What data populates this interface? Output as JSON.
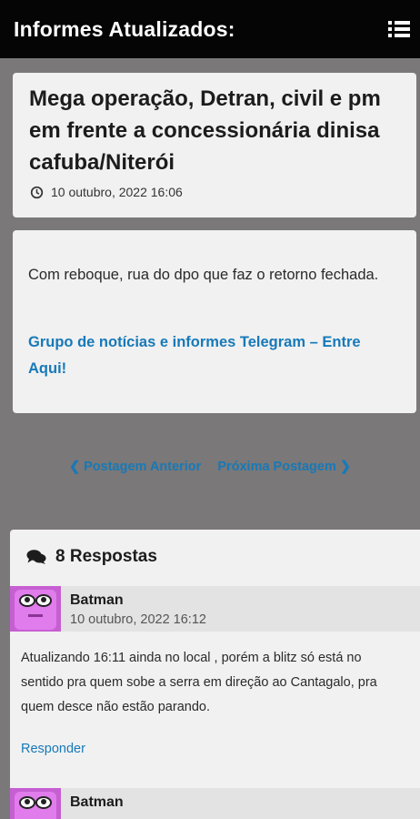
{
  "header": {
    "title": "Informes Atualizados:",
    "menu_icon": "menu-list-icon"
  },
  "post": {
    "title": "Mega operação, Detran, civil e pm em frente a concessionária dinisa cafuba/Niterói",
    "date": "10 outubro, 2022 16:06",
    "body": "Com reboque, rua do dpo que faz o retorno fechada.",
    "link": "Grupo de notícias e informes Telegram – Entre Aqui!"
  },
  "nav": {
    "prev": "❮ Postagem Anterior",
    "next": "Próxima Postagem ❯"
  },
  "comments": {
    "count_label": "8 Respostas",
    "items": [
      {
        "author": "Batman",
        "date": "10 outubro, 2022 16:12",
        "text": "Atualizando 16:11 ainda no local , porém a blitz só está no sentido pra quem sobe a serra em direção ao Cantagalo, pra quem desce não estão parando.",
        "reply": "Responder"
      },
      {
        "author": "Batman"
      }
    ]
  },
  "colors": {
    "topbar": "#050505",
    "background": "#7a7878",
    "card": "#f1f1f1",
    "link": "#1779b8",
    "avatar": "#d86de3"
  }
}
